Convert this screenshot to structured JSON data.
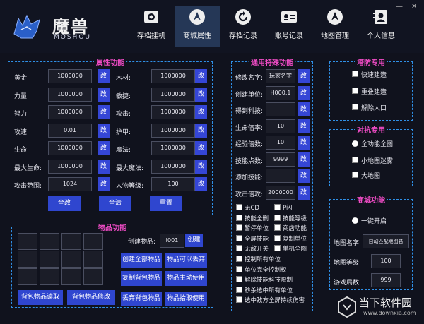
{
  "header": {
    "logo_text": "魔兽",
    "logo_sub": "MOSHOU",
    "nav": [
      {
        "label": "存档挂机",
        "icon": "camera-icon"
      },
      {
        "label": "商城属性",
        "icon": "compass-icon"
      },
      {
        "label": "存档记录",
        "icon": "refresh-icon"
      },
      {
        "label": "账号记录",
        "icon": "id-card-icon"
      },
      {
        "label": "地图管理",
        "icon": "compass-icon"
      },
      {
        "label": "个人信息",
        "icon": "profile-icon"
      }
    ],
    "active_nav": "商城属性",
    "minimize": "—",
    "close": "✕"
  },
  "attributes": {
    "title": "属性功能",
    "change_label": "改",
    "fields": [
      {
        "label": "黄金:",
        "value": "1000000"
      },
      {
        "label": "木材:",
        "value": "1000000"
      },
      {
        "label": "力量:",
        "value": "1000000"
      },
      {
        "label": "敏捷:",
        "value": "1000000"
      },
      {
        "label": "智力:",
        "value": "1000000"
      },
      {
        "label": "攻击:",
        "value": "1000000"
      },
      {
        "label": "攻速:",
        "value": "0.01"
      },
      {
        "label": "护甲:",
        "value": "1000000"
      },
      {
        "label": "生命:",
        "value": "1000000"
      },
      {
        "label": "魔法:",
        "value": "1000000"
      },
      {
        "label": "最大生命:",
        "value": "1000000"
      },
      {
        "label": "最大魔法:",
        "value": "1000000"
      },
      {
        "label": "攻击范围:",
        "value": "1024"
      },
      {
        "label": "人物等级:",
        "value": "100"
      }
    ],
    "buttons": [
      "全改",
      "全清",
      "重置"
    ]
  },
  "items": {
    "title": "物品功能",
    "create_label": "创建物品:",
    "create_value": "I001",
    "create_button": "创建",
    "buttons": [
      "创建全部物品",
      "物品可以丢弃",
      "复制背包物品",
      "物品主动使用",
      "丢弃背包物品",
      "物品拾取使用",
      "背包物品读取",
      "背包物品修改"
    ]
  },
  "special": {
    "title": "通用特殊功能",
    "change_label": "改",
    "fields": [
      {
        "label": "修改名字:",
        "value": "玩家名字"
      },
      {
        "label": "创建单位:",
        "value": "H000,1"
      },
      {
        "label": "得到科技:",
        "value": ""
      },
      {
        "label": "生命倍率:",
        "value": "10"
      },
      {
        "label": "经验倍数:",
        "value": "10"
      },
      {
        "label": "技能点数:",
        "value": "9999"
      },
      {
        "label": "添加技能:",
        "value": ""
      },
      {
        "label": "攻击倍攻:",
        "value": "2000000"
      }
    ],
    "checks_two_col": [
      [
        "无CD",
        "P闪"
      ],
      [
        "技能全删",
        "技能等级"
      ],
      [
        "暂停单位",
        "商店功能"
      ],
      [
        "全屏技能",
        "复制单位"
      ],
      [
        "无敌开关",
        "单机全图"
      ]
    ],
    "checks_one_col": [
      "控制所有单位",
      "单位完全控制权",
      "解除技能科技限制",
      "秒杀选中所有单位",
      "选中敌方全屏持续伤害"
    ]
  },
  "tower": {
    "title": "塔防专用",
    "items": [
      "快速建造",
      "重叠建造",
      "解除人口"
    ]
  },
  "battle": {
    "title": "对抗专用",
    "items": [
      "全功能全图",
      "小地图迷雾",
      "大地图"
    ]
  },
  "shop": {
    "title": "商城功能",
    "one_click": "一键开启",
    "map_name_label": "地图名字:",
    "map_name_value": "自动匹配地图名",
    "map_level_label": "地图等级:",
    "map_level_value": "100",
    "games_label": "游戏局数:",
    "games_value": "999"
  },
  "watermark": {
    "title": "当下软件园",
    "sub": "www.downxia.com"
  }
}
